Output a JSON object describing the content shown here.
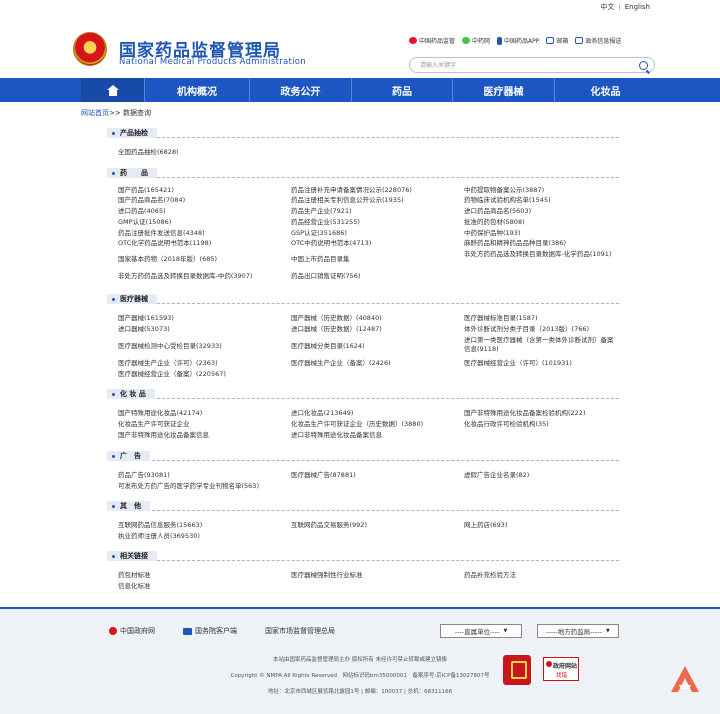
{
  "lang": {
    "zh": "中文",
    "sep": "|",
    "en": "English"
  },
  "site": {
    "name_cn": "国家药品监督管理局",
    "name_en": "National Medical Products Administration"
  },
  "quick_links": [
    "中国药品监管",
    "中药网",
    "中国药品APP",
    "邮箱",
    "政务信息报送"
  ],
  "search": {
    "placeholder": "请输入关键字"
  },
  "nav": [
    "机构概况",
    "政务公开",
    "药品",
    "医疗器械",
    "化妆品"
  ],
  "breadcrumb": {
    "home": "网站首页",
    "sep": ">>",
    "current": "数据查询"
  },
  "sections": {
    "s1": {
      "title": "产品抽检",
      "rows": [
        [
          "全国药品抽检(6828)"
        ]
      ]
    },
    "s2": {
      "title": "药　　品",
      "rows": [
        [
          "国产药品(165421)",
          "药品注册补充申请备案情况公示(228076)",
          "中药提取物备案公示(3887)"
        ],
        [
          "国产药品商品名(7084)",
          "药品注册相关专利信息公开公示(1935)",
          "药物临床试验机构名单(1545)"
        ],
        [
          "进口药品(4065)",
          "药品生产企业(7921)",
          "进口药品商品名(5603)"
        ],
        [
          "GMP认证(15086)",
          "药品经营企业(531255)",
          "批准的药包材(5808)"
        ],
        [
          "药品注册批件发送信息(4348)",
          "GSP认证(351686)",
          "中药保护品种(193)"
        ],
        [
          "OTC化学药品说明书范本(1198)",
          "OTC中药说明书范本(4713)",
          "麻醉药品和精神药品品种目录(386)"
        ],
        [
          "国家基本药物（2018年版）(685)",
          "中国上市药品目录集",
          "非处方药药品选及转换目录数据库-化学药品(1091)"
        ],
        [
          "非处方药药品选及转换目录数据库-中药(3907)",
          "药品出口销售证明(756)",
          ""
        ]
      ]
    },
    "s3": {
      "title": "医疗器械",
      "rows": [
        [
          "国产器械(161593)",
          "国产器械（历史数据）(40840)",
          "医疗器械标准目录(1587)"
        ],
        [
          "进口器械(53073)",
          "进口器械（历史数据）(12487)",
          "体外诊断试剂分类子目录（2013版）(766)"
        ],
        [
          "医疗器械检测中心受检目录(32933)",
          "医疗器械分类目录(1624)",
          "进口第一类医疗器械（含第一类体外诊断试剂）备案信息(9118)"
        ],
        [
          "医疗器械生产企业（许可）(2363)",
          "医疗器械生产企业（备案）(2426)",
          "医疗器械经营企业（许可）(101931)"
        ],
        [
          "医疗器械经营企业（备案）(220567)",
          "",
          ""
        ]
      ]
    },
    "s4": {
      "title": "化 妆 品",
      "rows": [
        [
          "国产特殊用途化妆品(42174)",
          "进口化妆品(213649)",
          "国产非特殊用途化妆品备案检验机构(222)"
        ],
        [
          "化妆品生产许可获证企业",
          "化妆品生产许可获证企业（历史数据）(3880)",
          "化妆品行政许可检验机构(35)"
        ],
        [
          "国产非特殊用途化妆品备案信息",
          "进口非特殊用途化妆品备案信息",
          ""
        ]
      ]
    },
    "s5": {
      "title": "广　告",
      "rows": [
        [
          "药品广告(93081)",
          "医疗器械广告(87881)",
          "虚假广告企业名录(82)"
        ],
        [
          "可发布处方药广告的医学药学专业刊物名单(563)",
          "",
          ""
        ]
      ]
    },
    "s6": {
      "title": "其　他",
      "rows": [
        [
          "互联网药品信息服务(15663)",
          "互联网药品交易服务(992)",
          "网上药店(693)"
        ],
        [
          "执业药师注册人员(369530)",
          "",
          ""
        ]
      ]
    },
    "s7": {
      "title": "相关链接",
      "rows": [
        [
          "药包材标准",
          "医疗器械强制性行业标准",
          "药品补充检验方法"
        ],
        [
          "信息化标准",
          "",
          ""
        ]
      ]
    }
  },
  "footer": {
    "links": [
      "中国政府网",
      "国务院客户端",
      "国家市场监督管理总局"
    ],
    "select1": "----直属单位----",
    "select2": "-----地方药监局-----",
    "line1": "本站由国家药品监督管理局主办 版权所有 未经许可禁止转载或建立镜像",
    "line2": "Copyright © NMPA All Rights Reserved　网站标识码bm35000001　备案序号:京ICP备13027807号",
    "line3": "地址：北京市西城区展览路北露园1号 | 邮编：100037 | 总机：68311166",
    "badge_top": "政府网站",
    "badge_bottom": "找错"
  },
  "colors": {
    "brand_blue": "#1c56c2",
    "emblem_red": "#d8141b"
  }
}
